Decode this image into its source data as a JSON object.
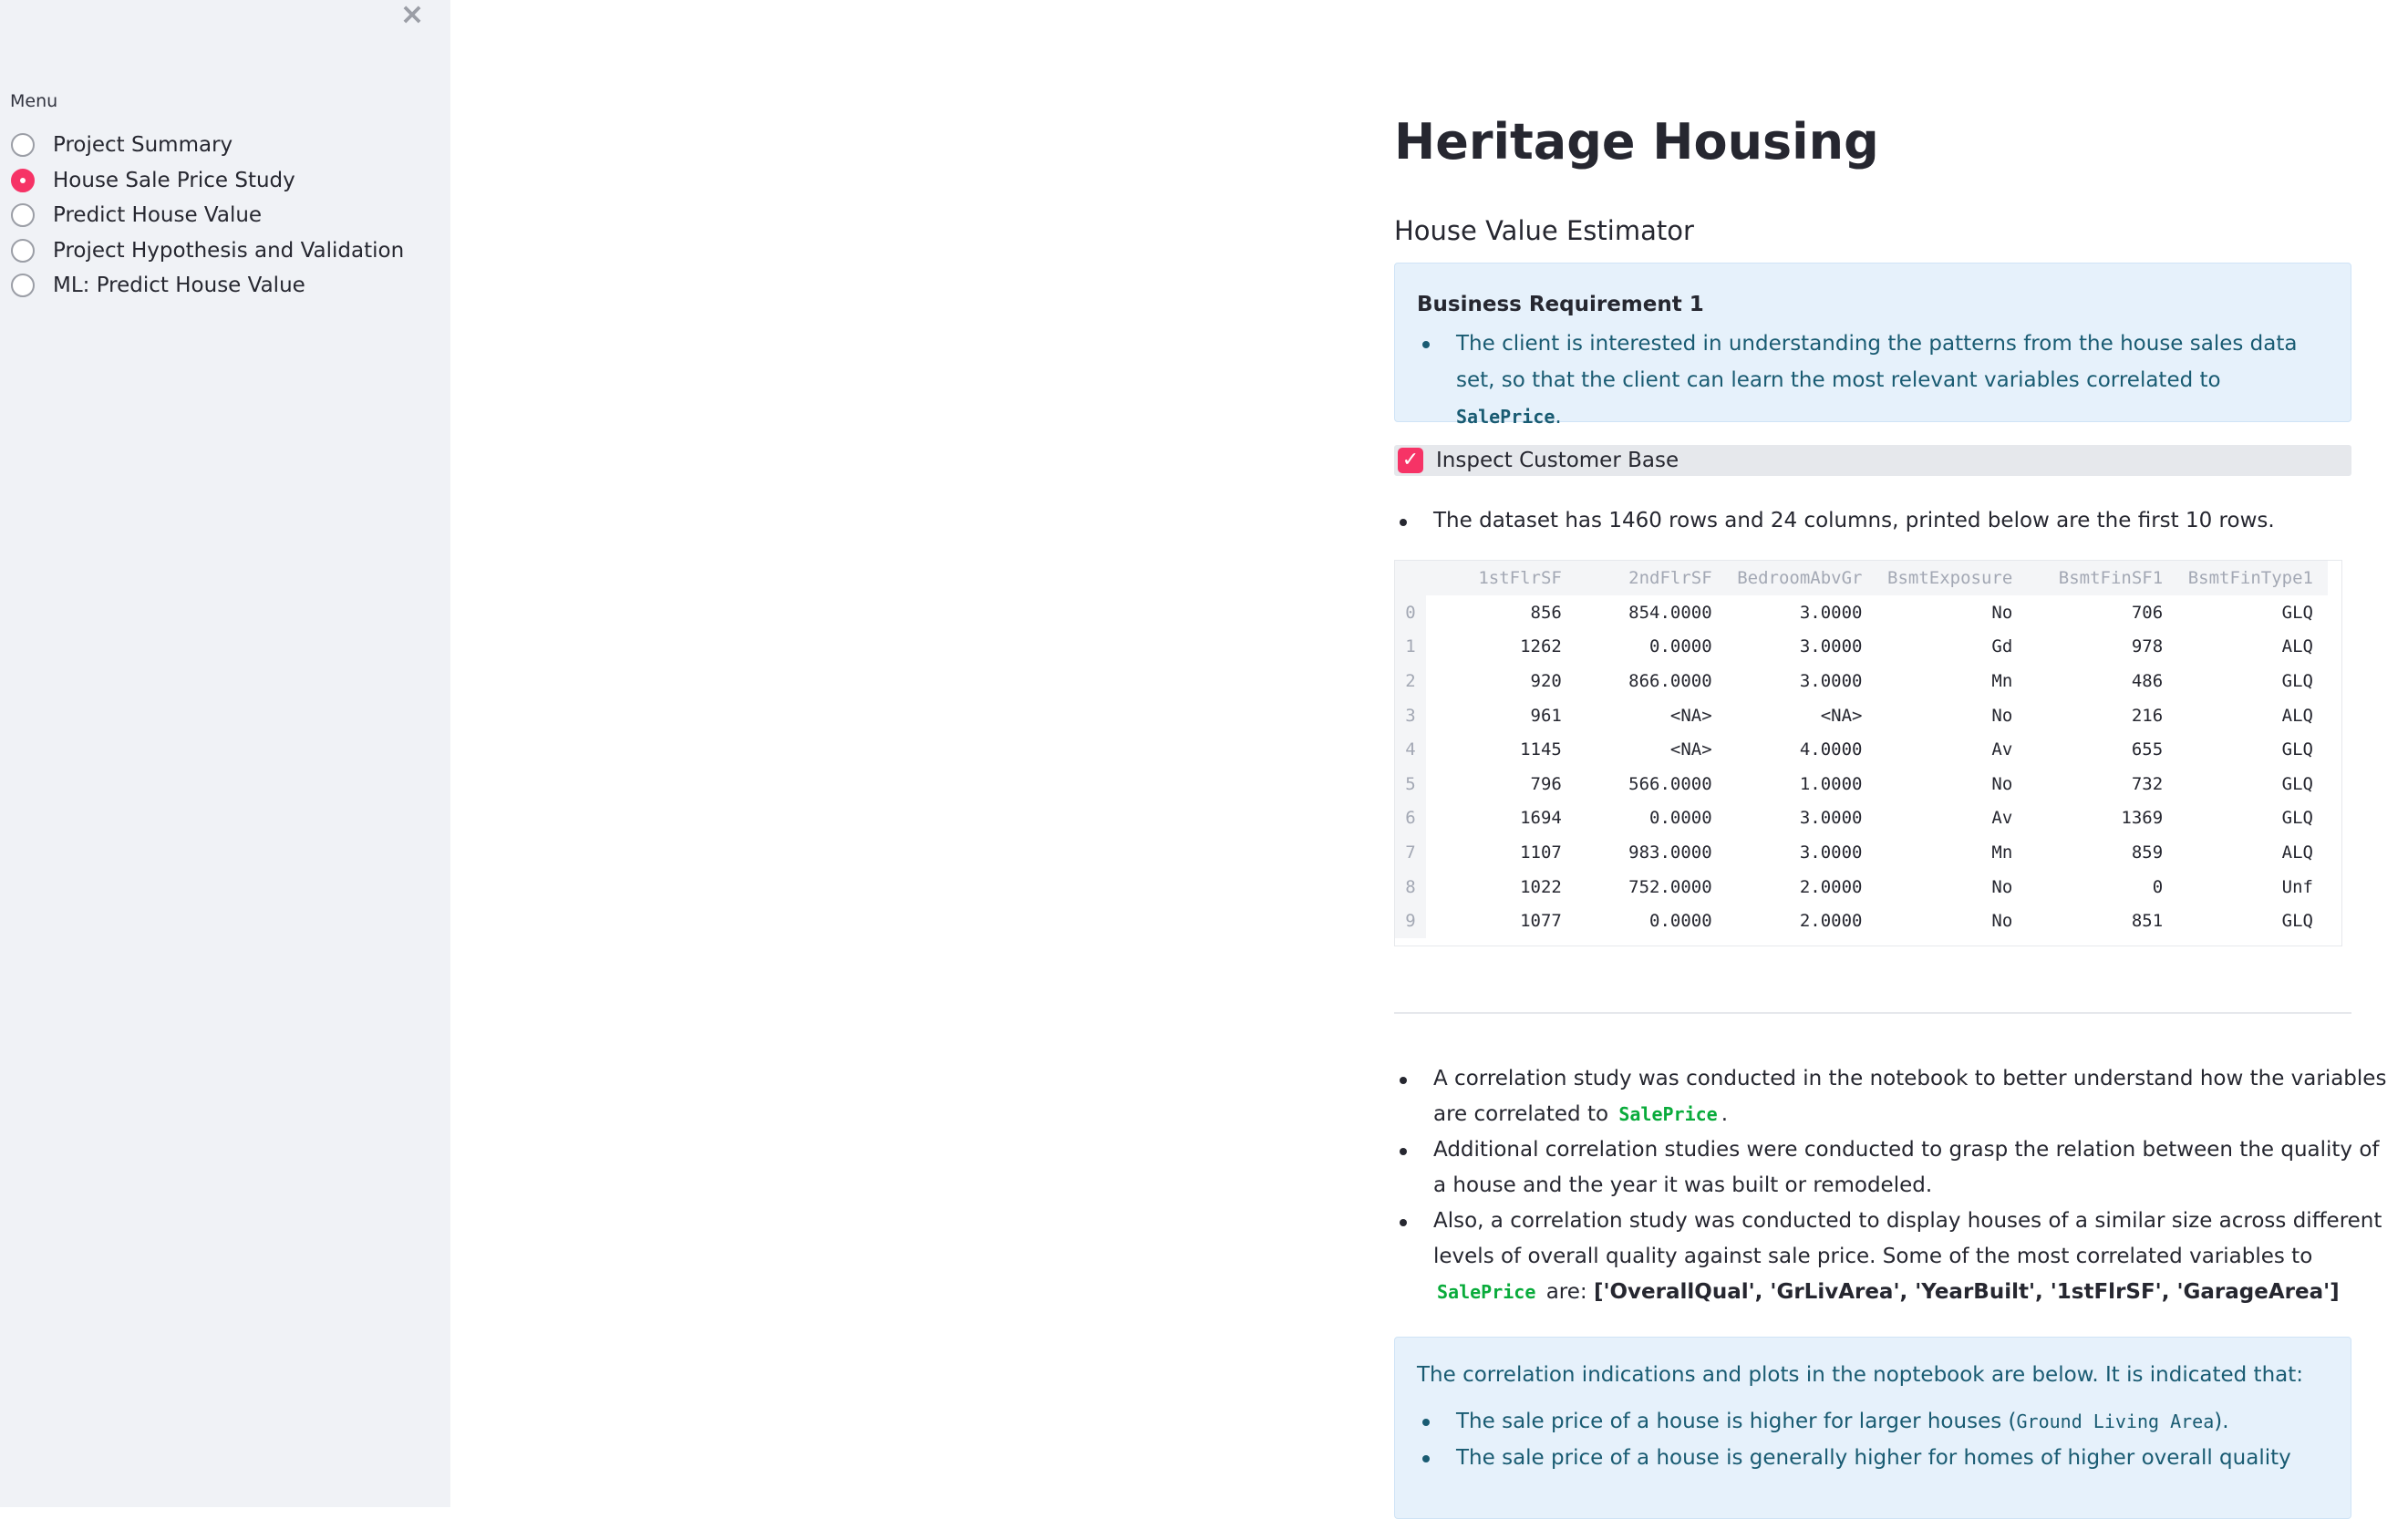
{
  "sidebar": {
    "close_icon": "×",
    "menu_label": "Menu",
    "items": [
      {
        "label": "Project Summary",
        "selected": false
      },
      {
        "label": "House Sale Price Study",
        "selected": true
      },
      {
        "label": "Predict House Value",
        "selected": false
      },
      {
        "label": "Project Hypothesis and Validation",
        "selected": false
      },
      {
        "label": "ML: Predict House Value",
        "selected": false
      }
    ]
  },
  "main": {
    "title": "Heritage Housing",
    "subtitle": "House Value Estimator",
    "requirement": {
      "title": "Business Requirement 1",
      "text_before": "The client is interested in understanding the patterns from the house sales data set, so that the client can learn the most relevant variables correlated to ",
      "code": "SalePrice",
      "text_after": "."
    },
    "checkbox": {
      "label": "Inspect Customer Base",
      "checked": true
    },
    "dataset_note": "The dataset has 1460 rows and 24 columns, printed below are the first 10 rows.",
    "table": {
      "columns": [
        "1stFlrSF",
        "2ndFlrSF",
        "BedroomAbvGr",
        "BsmtExposure",
        "BsmtFinSF1",
        "BsmtFinType1"
      ],
      "rows": [
        [
          "0",
          "856",
          "854.0000",
          "3.0000",
          "No",
          "706",
          "GLQ"
        ],
        [
          "1",
          "1262",
          "0.0000",
          "3.0000",
          "Gd",
          "978",
          "ALQ"
        ],
        [
          "2",
          "920",
          "866.0000",
          "3.0000",
          "Mn",
          "486",
          "GLQ"
        ],
        [
          "3",
          "961",
          "<NA>",
          "<NA>",
          "No",
          "216",
          "ALQ"
        ],
        [
          "4",
          "1145",
          "<NA>",
          "4.0000",
          "Av",
          "655",
          "GLQ"
        ],
        [
          "5",
          "796",
          "566.0000",
          "1.0000",
          "No",
          "732",
          "GLQ"
        ],
        [
          "6",
          "1694",
          "0.0000",
          "3.0000",
          "Av",
          "1369",
          "GLQ"
        ],
        [
          "7",
          "1107",
          "983.0000",
          "3.0000",
          "Mn",
          "859",
          "ALQ"
        ],
        [
          "8",
          "1022",
          "752.0000",
          "2.0000",
          "No",
          "0",
          "Unf"
        ],
        [
          "9",
          "1077",
          "0.0000",
          "2.0000",
          "No",
          "851",
          "GLQ"
        ]
      ]
    },
    "correlation": {
      "item1_before": "A correlation study was conducted in the notebook to better understand how the variables are correlated to",
      "item1_code": "SalePrice",
      "item1_after": ".",
      "item2": "Additional correlation studies were conducted to grasp the relation between the quality of a house and the year it was built or remodeled.",
      "item3_before": "Also, a correlation study was conducted to display houses of a similar size across different levels of overall quality against sale price. Some of the most correlated variables to",
      "item3_code": "SalePrice",
      "item3_mid": "are:",
      "item3_bold": "['OverallQual', 'GrLivArea', 'YearBuilt', '1stFlrSF', 'GarageArea']"
    },
    "findings": {
      "intro": "The correlation indications and plots in the noptebook are below. It is indicated that:",
      "item1_before": "The sale price of a house is higher for larger houses (",
      "item1_code": "Ground Living Area",
      "item1_after": ").",
      "item2": "The sale price of a house is generally higher for homes of higher overall quality"
    }
  },
  "colors": {
    "accent": "#f63366",
    "sidebar_bg": "#f0f2f6",
    "info_bg": "#e6f1fb",
    "info_text": "#195b72",
    "code_green": "#09ab3b"
  }
}
